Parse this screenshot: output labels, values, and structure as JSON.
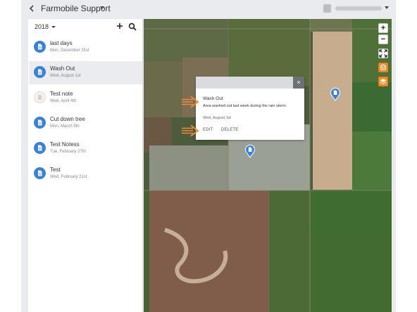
{
  "header": {
    "back_icon": "chevron-left-icon",
    "title": "Farmobile Support",
    "user_name": "",
    "dropdown_icon": "caret-down-icon"
  },
  "sidebar": {
    "year": "2018",
    "add_icon": "plus-icon",
    "search_icon": "search-icon",
    "notes": [
      {
        "title": "last days",
        "date": "Mon, December 31st",
        "icon": "document-icon",
        "selected": false
      },
      {
        "title": "Wash Out",
        "date": "Wed, August 1st",
        "icon": "document-icon",
        "selected": true
      },
      {
        "title": "Test note",
        "date": "Wed, April 4th",
        "icon": "pending-document-icon",
        "selected": false
      },
      {
        "title": "Cut down tree",
        "date": "Mon, March 5th",
        "icon": "document-icon",
        "selected": false
      },
      {
        "title": "Test Notess",
        "date": "Tue, February 27th",
        "icon": "document-icon",
        "selected": false
      },
      {
        "title": "Test",
        "date": "Wed, February 21st",
        "icon": "document-icon",
        "selected": false
      }
    ]
  },
  "map": {
    "controls": {
      "zoom_in": "+",
      "zoom_out": "−",
      "fullscreen_icon": "expand-icon",
      "layer_icon": "field-layer-icon",
      "stack_icon": "layers-icon"
    },
    "popup": {
      "close": "×",
      "title": "Wash Out",
      "description": "Area washed out last week during the rain storm.",
      "date": "Wed, August 1st",
      "edit_label": "EDIT",
      "delete_label": "DELETE"
    }
  },
  "colors": {
    "accent": "#3b82d6",
    "annotation_arrow": "#f08a3a",
    "control_orange": "#f28c28"
  }
}
